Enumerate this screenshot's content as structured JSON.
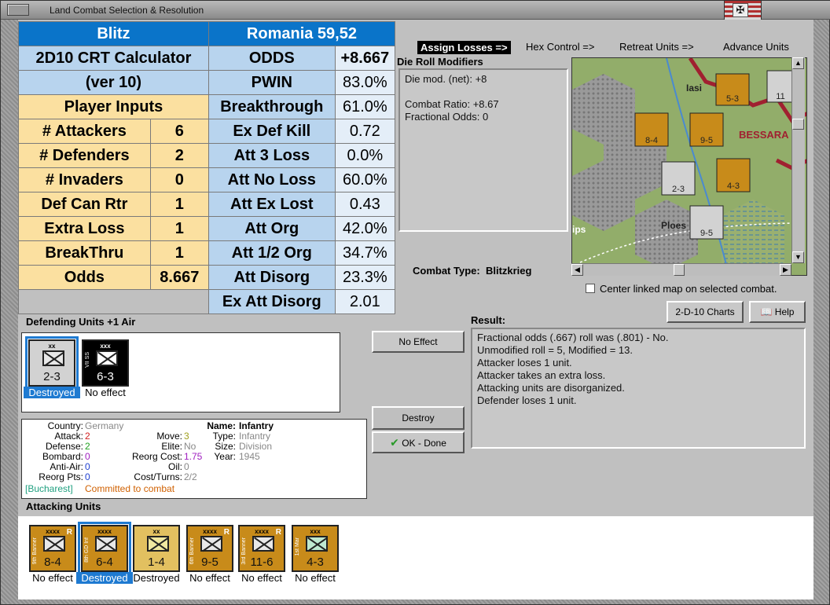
{
  "window": {
    "title": "Land Combat Selection & Resolution"
  },
  "calc": {
    "left_title": "Blitz",
    "right_title": "Romania 59,52",
    "calc_title_1": "2D10 CRT Calculator",
    "calc_title_2": "(ver 10)",
    "player_inputs": "Player Inputs",
    "inputs": [
      {
        "label": "# Attackers",
        "value": "6"
      },
      {
        "label": "# Defenders",
        "value": "2"
      },
      {
        "label": "# Invaders",
        "value": "0"
      },
      {
        "label": "Def Can Rtr",
        "value": "1"
      },
      {
        "label": "Extra Loss",
        "value": "1"
      },
      {
        "label": "BreakThru",
        "value": "1"
      },
      {
        "label": "Odds",
        "value": "8.667"
      }
    ],
    "results": [
      {
        "label": "ODDS",
        "value": "+8.667"
      },
      {
        "label": "PWIN",
        "value": "83.0%"
      },
      {
        "label": "Breakthrough",
        "value": "61.0%"
      },
      {
        "label": "Ex Def Kill",
        "value": "0.72"
      },
      {
        "label": "Att 3 Loss",
        "value": "0.0%"
      },
      {
        "label": "Att No Loss",
        "value": "60.0%"
      },
      {
        "label": "Att Ex Lost",
        "value": "0.43"
      },
      {
        "label": "Att Org",
        "value": "42.0%"
      },
      {
        "label": "Att 1/2 Org",
        "value": "34.7%"
      },
      {
        "label": "Att Disorg",
        "value": "23.3%"
      },
      {
        "label": "Ex Att Disorg",
        "value": "2.01"
      }
    ]
  },
  "tabs": [
    "Assign Losses =>",
    "Hex Control =>",
    "Retreat Units =>",
    "Advance Units"
  ],
  "die_roll": {
    "title": "Die Roll Modifiers",
    "line1": "Die mod. (net): +8",
    "line2": "Combat Ratio: +8.67",
    "line3": "Fractional Odds: 0"
  },
  "combat_type": {
    "label": "Combat Type:",
    "value": "Blitzkrieg"
  },
  "map": {
    "labels": [
      "Iasi",
      "BESSARA",
      "Ploes",
      "ips"
    ]
  },
  "center_map": "Center linked map on selected combat.",
  "buttons": {
    "charts": "2-D-10 Charts",
    "help": "Help",
    "no_effect": "No Effect",
    "destroy": "Destroy",
    "ok": "OK - Done"
  },
  "defending": {
    "title": "Defending Units +1 Air",
    "units": [
      {
        "size": "xx",
        "str": "2-3",
        "side": "",
        "status": "Destroyed",
        "style": "gray",
        "selected": true
      },
      {
        "size": "xxx",
        "str": "6-3",
        "side": "VII SS",
        "status": "No effect",
        "style": "black",
        "selected": false
      }
    ]
  },
  "result": {
    "title": "Result:",
    "lines": [
      "Fractional odds (.667) roll was (.801)  - No.",
      "Unmodified roll = 5, Modified = 13.",
      "Attacker loses 1 unit.",
      "Attacker takes an extra loss.",
      "Attacking units are disorganized.",
      "Defender loses 1 unit."
    ]
  },
  "unit_info": {
    "country_k": "Country:",
    "country_v": "Germany",
    "attack_k": "Attack:",
    "attack_v": "2",
    "defense_k": "Defense:",
    "defense_v": "2",
    "bombard_k": "Bombard:",
    "bombard_v": "0",
    "antiair_k": "Anti-Air:",
    "antiair_v": "0",
    "reorg_k": "Reorg Pts:",
    "reorg_v": "0",
    "move_k": "Move:",
    "move_v": "3",
    "elite_k": "Elite:",
    "elite_v": "No",
    "reorgcost_k": "Reorg Cost:",
    "reorgcost_v": "1.75",
    "oil_k": "Oil:",
    "oil_v": "0",
    "costturns_k": "Cost/Turns:",
    "costturns_v": "2/2",
    "name_k": "Name:",
    "name_v": "Infantry",
    "type_k": "Type:",
    "type_v": "Infantry",
    "size_k": "Size:",
    "size_v": "Division",
    "year_k": "Year:",
    "year_v": "1945",
    "location": "[Bucharest]",
    "committed": "Committed to combat"
  },
  "attacking": {
    "title": "Attacking Units",
    "units": [
      {
        "size": "xxxx",
        "str": "8-4",
        "side": "9th Banner",
        "status": "No effect",
        "style": "gold",
        "r": "R",
        "selected": false
      },
      {
        "size": "xxxx",
        "str": "6-4",
        "side": "8th GD Inf",
        "status": "Destroyed",
        "style": "gold",
        "r": "",
        "selected": true
      },
      {
        "size": "xx",
        "str": "1-4",
        "side": "",
        "status": "Destroyed",
        "style": "gold",
        "r": "",
        "selected": false
      },
      {
        "size": "xxxx",
        "str": "9-5",
        "side": "6th Banner",
        "status": "No effect",
        "style": "gold",
        "r": "R",
        "selected": false
      },
      {
        "size": "xxxx",
        "str": "11-6",
        "side": "3rd Banner",
        "status": "No effect",
        "style": "gold",
        "r": "R",
        "selected": false
      },
      {
        "size": "xxx",
        "str": "4-3",
        "side": "1st Mar",
        "status": "No effect",
        "style": "gold",
        "r": "",
        "selected": false
      }
    ]
  },
  "colors": {
    "header_blue": "#0a74c9",
    "light_blue": "#b8d4ee",
    "yellow": "#fbe0a0",
    "selection": "#1e7ad1",
    "counter_gold": "#c88b1a"
  }
}
